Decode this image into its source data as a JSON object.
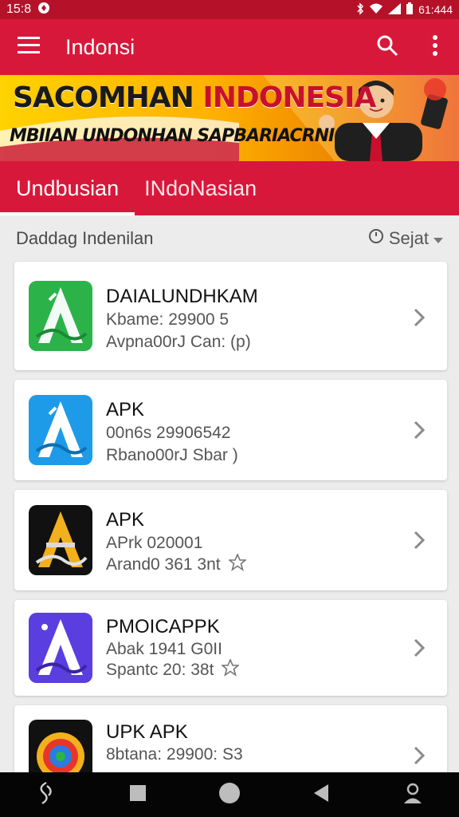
{
  "status_bar": {
    "time_left": "15:8",
    "time_right": "61:444",
    "network_label": "4G",
    "battery_label": "bat"
  },
  "app_bar": {
    "title": "Indonsi"
  },
  "banner": {
    "headline_part1": "SACOMHAN",
    "headline_part2": "INDONESIA",
    "subline": "MBIIAN UNDONHAN SAPBARIACRNI"
  },
  "tabs": [
    {
      "label": "Undbusian"
    },
    {
      "label": "INdoNasian"
    }
  ],
  "list_header": {
    "label": "Daddag Indenilan",
    "sort_label": "Sejat"
  },
  "apps": [
    {
      "name": "DAIALUNDHKAM",
      "line1": "Kbame: 29900 5",
      "line2": "Avpna00rJ Can: (p)",
      "icon_style": "green"
    },
    {
      "name": "APK",
      "line1": "00n6s 29906542",
      "line2": "Rbano00rJ Sbar )",
      "icon_style": "blue"
    },
    {
      "name": "APK",
      "line1": "APrk 020001",
      "line2": "Arand0 361 3nt",
      "icon_style": "black-gold"
    },
    {
      "name": "PMOICAPPK",
      "line1": "Abak 1941 G0II",
      "line2": "Spantc 20: 38t",
      "icon_style": "purple"
    },
    {
      "name": "UPK APK",
      "line1": "8btana: 29900: S3",
      "line2": "",
      "icon_style": "black-multicolor"
    }
  ],
  "colors": {
    "primary": "#d8183a",
    "status_bar": "#b5122a",
    "background": "#ececec",
    "nav": "#050505"
  },
  "icons": {
    "menu": "hamburger-icon",
    "search": "search-icon",
    "more": "more-vert-icon",
    "sort": "clock-icon",
    "chevron": "chevron-right-icon",
    "star": "star-icon"
  }
}
